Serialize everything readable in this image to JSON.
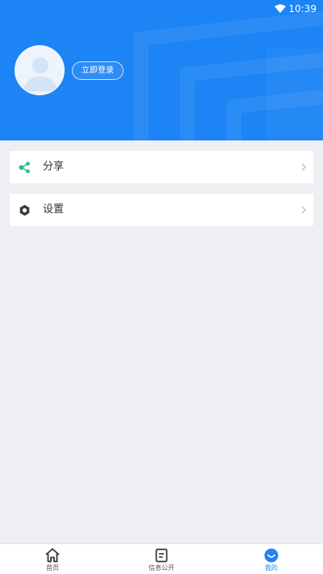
{
  "status_bar": {
    "time": "10:39",
    "wifi_icon": "wifi-icon"
  },
  "profile": {
    "avatar_icon": "user-avatar-icon",
    "login_label": "立即登录"
  },
  "menu": {
    "items": [
      {
        "label": "分享",
        "icon": "share-icon"
      },
      {
        "label": "设置",
        "icon": "gear-icon"
      }
    ]
  },
  "tabbar": {
    "items": [
      {
        "label": "首页",
        "icon": "home-icon",
        "active": false
      },
      {
        "label": "信息公开",
        "icon": "document-icon",
        "active": false
      },
      {
        "label": "我的",
        "icon": "profile-icon",
        "active": true
      }
    ]
  },
  "colors": {
    "brand": "#1c84f5",
    "background": "#efeef3",
    "share_icon": "#2bbf8a"
  }
}
